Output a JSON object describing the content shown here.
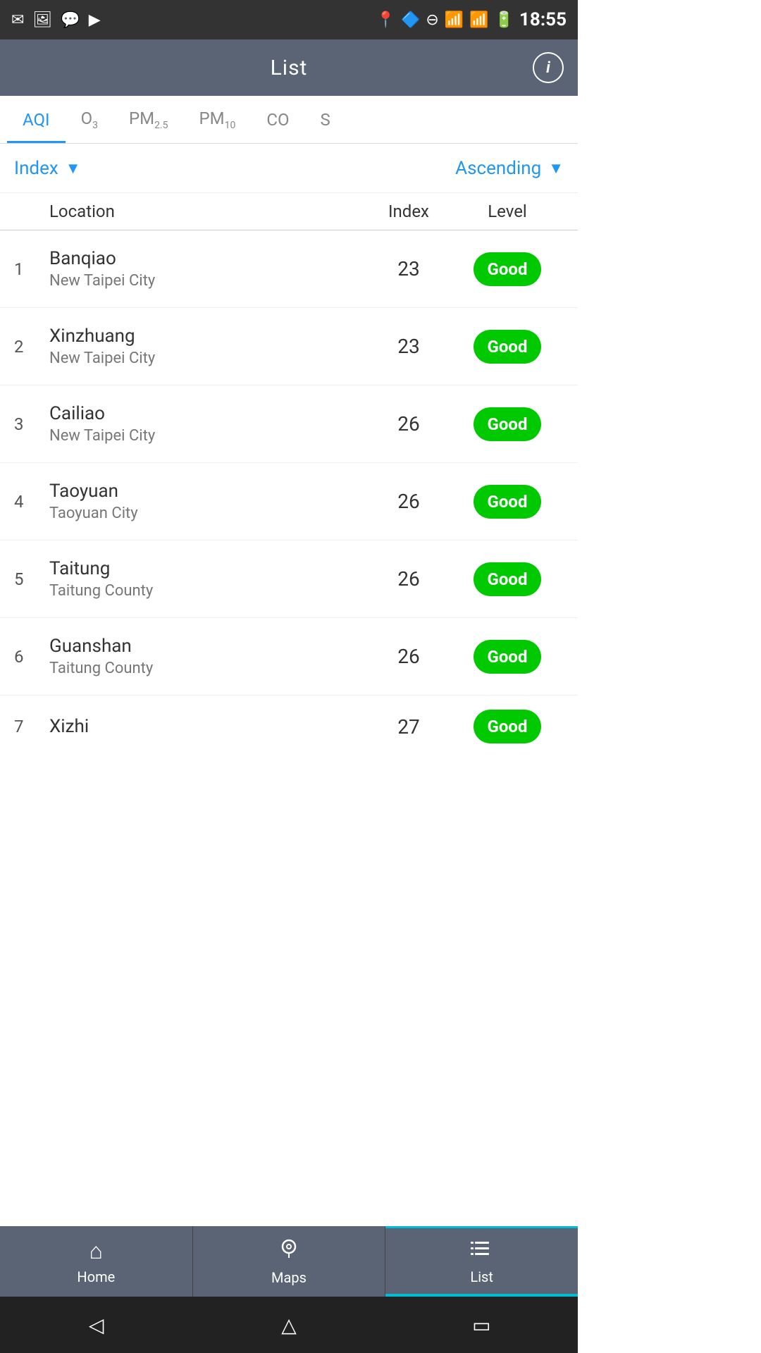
{
  "statusBar": {
    "time": "18:55",
    "icons": [
      "mail",
      "image",
      "messenger",
      "play"
    ]
  },
  "header": {
    "title": "List",
    "infoBtn": "i"
  },
  "tabs": [
    {
      "id": "aqi",
      "label": "AQI",
      "sub": "",
      "active": true
    },
    {
      "id": "o3",
      "label": "O",
      "sub": "3",
      "active": false
    },
    {
      "id": "pm25",
      "label": "PM",
      "sub": "2.5",
      "active": false
    },
    {
      "id": "pm10",
      "label": "PM",
      "sub": "10",
      "active": false
    },
    {
      "id": "co",
      "label": "CO",
      "sub": "",
      "active": false
    },
    {
      "id": "s",
      "label": "S",
      "sub": "",
      "active": false
    }
  ],
  "sortControls": {
    "sortByLabel": "Index",
    "orderLabel": "Ascending"
  },
  "columnHeaders": {
    "location": "Location",
    "index": "Index",
    "level": "Level"
  },
  "rows": [
    {
      "rank": 1,
      "name": "Banqiao",
      "city": "New Taipei City",
      "index": 23,
      "level": "Good"
    },
    {
      "rank": 2,
      "name": "Xinzhuang",
      "city": "New Taipei City",
      "index": 23,
      "level": "Good"
    },
    {
      "rank": 3,
      "name": "Cailiao",
      "city": "New Taipei City",
      "index": 26,
      "level": "Good"
    },
    {
      "rank": 4,
      "name": "Taoyuan",
      "city": "Taoyuan City",
      "index": 26,
      "level": "Good"
    },
    {
      "rank": 5,
      "name": "Taitung",
      "city": "Taitung County",
      "index": 26,
      "level": "Good"
    },
    {
      "rank": 6,
      "name": "Guanshan",
      "city": "Taitung County",
      "index": 26,
      "level": "Good"
    },
    {
      "rank": 7,
      "name": "Xizhi",
      "city": "",
      "index": 27,
      "level": "Good",
      "partial": true
    }
  ],
  "bottomNav": [
    {
      "id": "home",
      "label": "Home",
      "icon": "⌂"
    },
    {
      "id": "maps",
      "label": "Maps",
      "icon": "◎"
    },
    {
      "id": "list",
      "label": "List",
      "icon": "≡"
    }
  ],
  "androidNav": {
    "back": "◁",
    "home": "△",
    "recents": "▭"
  }
}
